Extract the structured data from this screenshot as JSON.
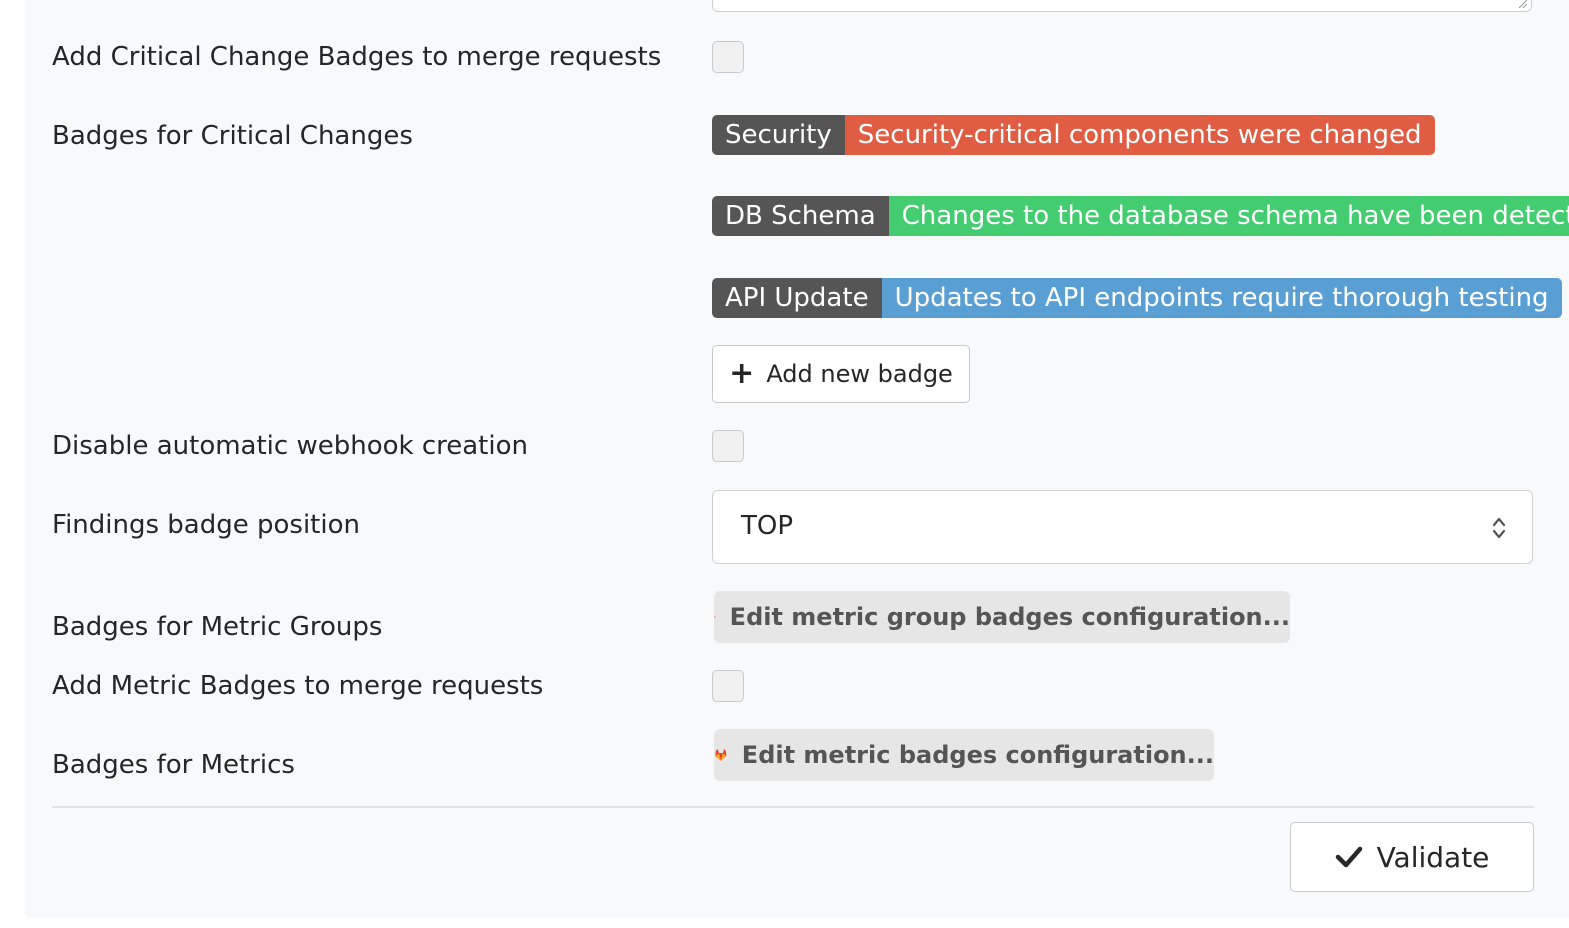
{
  "settings": {
    "critical_badges_toggle": {
      "label": "Add Critical Change Badges to merge requests",
      "checked": false
    },
    "critical_badges": {
      "label": "Badges for Critical Changes",
      "badges": [
        {
          "key": "Security",
          "message": "Security-critical components were changed",
          "color": "#e05d44"
        },
        {
          "key": "DB Schema",
          "message": "Changes to the database schema have been detected",
          "color": "#44cc71"
        },
        {
          "key": "API Update",
          "message": "Updates to API endpoints require thorough testing",
          "color": "#5a9fd4"
        }
      ],
      "add_button": "Add new badge"
    },
    "webhook_toggle": {
      "label": "Disable automatic webhook creation",
      "checked": false
    },
    "findings_position": {
      "label": "Findings badge position",
      "value": "TOP"
    },
    "metric_group_badges": {
      "label": "Badges for Metric Groups",
      "button": "Edit metric group badges configuration..."
    },
    "metric_badges_toggle": {
      "label": "Add Metric Badges to merge requests",
      "checked": false
    },
    "metric_badges": {
      "label": "Badges for Metrics",
      "button": "Edit metric badges configuration..."
    }
  },
  "actions": {
    "validate_label": "Validate"
  },
  "colors": {
    "badge_key_bg": "#555555",
    "panel_bg": "#f8f9fa"
  },
  "icons": {
    "plus": "plus-icon",
    "check": "check-icon",
    "gitlab": "gitlab-logo-icon",
    "select": "chevron-up-down-icon"
  }
}
